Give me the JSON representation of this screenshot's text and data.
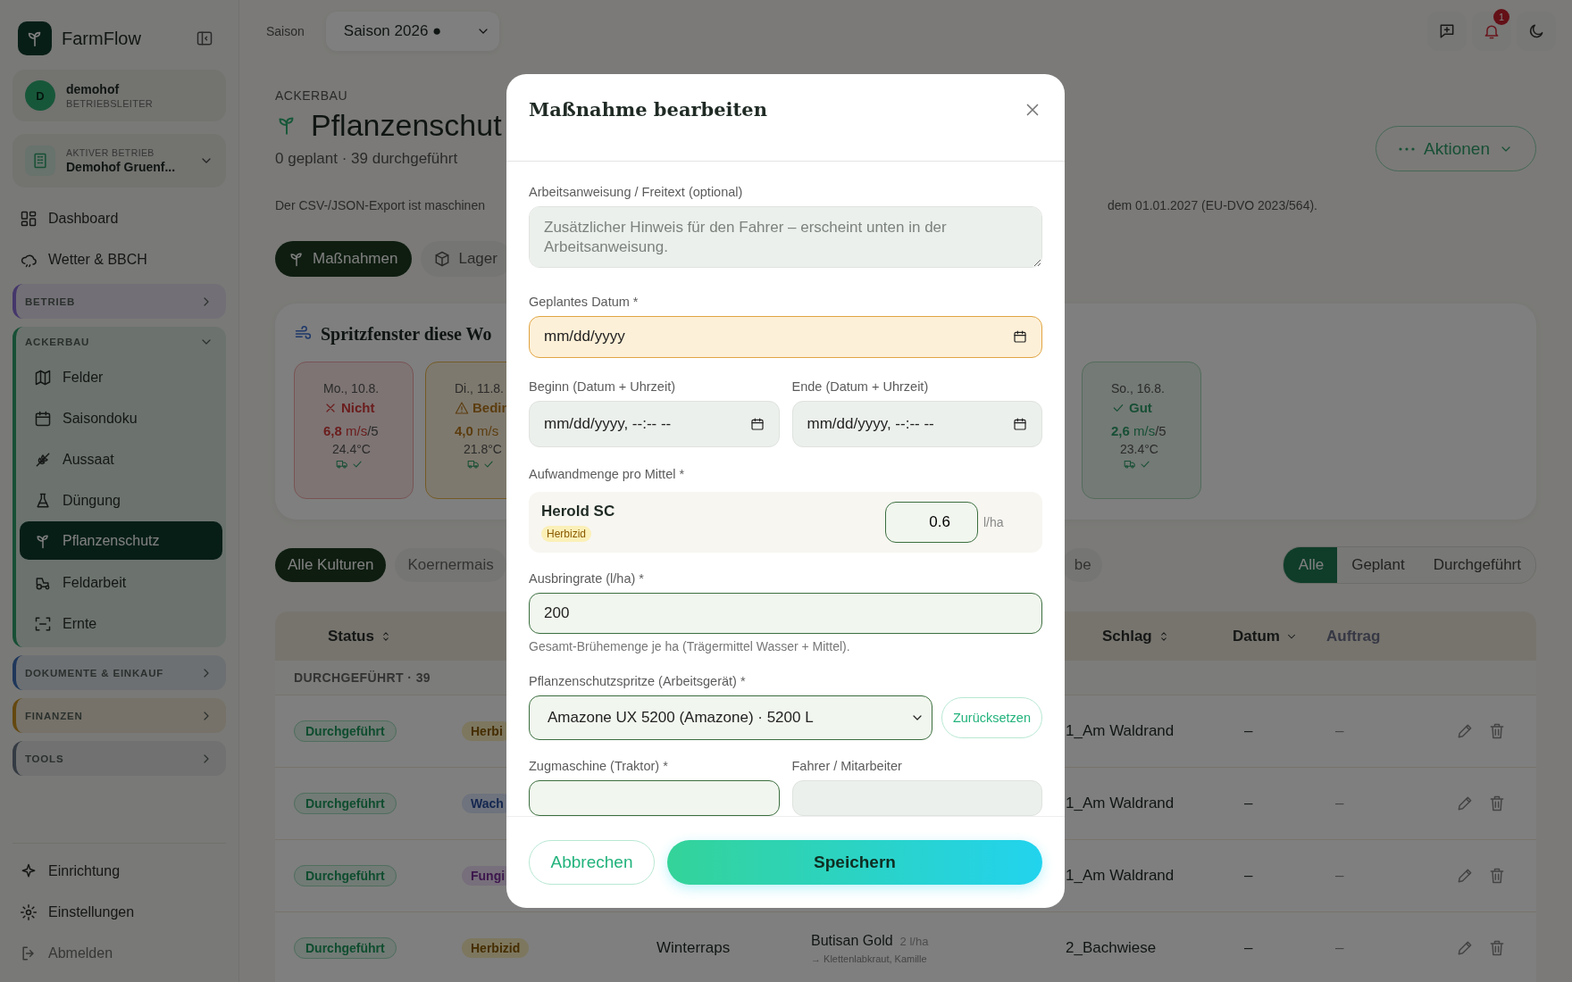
{
  "sidebar": {
    "brand": "FarmFlow",
    "user": {
      "initial": "D",
      "name": "demohof",
      "role": "BETRIEBSLEITER"
    },
    "farm": {
      "label": "AKTIVER BETRIEB",
      "name": "Demohof Gruenf..."
    },
    "nav": [
      {
        "label": "Dashboard",
        "selected": false
      },
      {
        "label": "Wetter & BBCH",
        "selected": false
      }
    ],
    "groups": [
      {
        "label": "BETRIEB",
        "kind": "company",
        "expanded": false
      },
      {
        "label": "ACKERBAU",
        "kind": "crops",
        "expanded": true,
        "items": [
          {
            "label": "Felder",
            "selected": false
          },
          {
            "label": "Saisondoku",
            "selected": false
          },
          {
            "label": "Aussaat",
            "selected": false
          },
          {
            "label": "Düngung",
            "selected": false
          },
          {
            "label": "Pflanzenschutz",
            "selected": true
          },
          {
            "label": "Feldarbeit",
            "selected": false
          },
          {
            "label": "Ernte",
            "selected": false
          }
        ]
      },
      {
        "label": "DOKUMENTE & EINKAUF",
        "kind": "documents",
        "expanded": false
      },
      {
        "label": "FINANZEN",
        "kind": "finance",
        "expanded": false
      },
      {
        "label": "TOOLS",
        "kind": "tools",
        "expanded": false
      }
    ],
    "footer": [
      {
        "label": "Einrichtung"
      },
      {
        "label": "Einstellungen"
      },
      {
        "label": "Abmelden"
      }
    ]
  },
  "topbar": {
    "season_label": "Saison",
    "season": "Saison 2026 ●",
    "notifications": "1"
  },
  "page": {
    "section": "ACKERBAU",
    "title": "Pflanzenschut",
    "subtitle": "0 geplant · 39 durchgeführt",
    "notice_start": "Der CSV-/JSON-Export ist maschinen",
    "notice_end": "dem 01.01.2027 (EU-DVO 2023/564).",
    "actions": "Aktionen",
    "tabs": [
      {
        "label": "Maßnahmen",
        "selected": true
      },
      {
        "label": "Lager",
        "selected": false
      }
    ],
    "spray_window": {
      "title": "Spritzfenster diese Wo",
      "days": [
        {
          "day": "Mo., 10.8.",
          "verdict": "Nicht",
          "kind": "bad",
          "wind": "6,8",
          "unit": "m/s",
          "max": "/5",
          "temp": "24.4°C"
        },
        {
          "day": "Di., 11.8.",
          "verdict": "Bedin",
          "kind": "limited",
          "wind": "4,0",
          "unit": "m/s",
          "temp": "21.8°C"
        }
      ],
      "days_after": [
        {
          "day": "So., 16.8.",
          "verdict": "Gut",
          "kind": "good",
          "wind": "2,6",
          "unit": "m/s",
          "max": "/5",
          "temp": "23.4°C"
        }
      ]
    },
    "crop_filters": [
      {
        "label": "Alle Kulturen",
        "selected": true
      },
      {
        "label": "Koernermais",
        "selected": false
      }
    ],
    "crop_filter_tail": {
      "label": "be",
      "selected": false
    },
    "status_filter": [
      {
        "label": "Alle",
        "selected": true
      },
      {
        "label": "Geplant",
        "selected": false
      },
      {
        "label": "Durchgeführt",
        "selected": false
      }
    ],
    "table": {
      "columns_left": [
        {
          "label": "Status",
          "sortable": true
        }
      ],
      "columns_right": [
        {
          "label": "Schlag",
          "sortable": true
        },
        {
          "label": "Datum",
          "sortable": true,
          "sorted": true
        },
        {
          "label": "Auftrag",
          "sortable": false
        }
      ],
      "group": "DURCHGEFÜHRT · 39",
      "rows": [
        {
          "status": "Durchgeführt",
          "type": {
            "label": "Herbi",
            "kind": "herbizid"
          },
          "field": "1_Am Waldrand",
          "date": "–",
          "order": "–"
        },
        {
          "status": "Durchgeführt",
          "type": {
            "label": "Wach",
            "kind": "regulator"
          },
          "field": "1_Am Waldrand",
          "date": "–",
          "order": "–"
        },
        {
          "status": "Durchgeführt",
          "type": {
            "label": "Fungi",
            "kind": "fungizid"
          },
          "field": "1_Am Waldrand",
          "date": "–",
          "order": "–"
        },
        {
          "status": "Durchgeführt",
          "type": {
            "label": "Herbizid",
            "kind": "herbizid"
          },
          "crop": "Winterraps",
          "agent": {
            "name": "Butisan Gold",
            "dose": "2 l/ha",
            "targets": "→ Klettenlabkraut, Kamille"
          },
          "field": "2_Bachwiese",
          "date": "–",
          "order": "–"
        }
      ]
    }
  },
  "modal": {
    "title": "Maßnahme bearbeiten",
    "note": {
      "label": "Arbeitsanweisung / Freitext (optional)",
      "placeholder": "Zusätzlicher Hinweis für den Fahrer – erscheint unten in der Arbeitsanweisung."
    },
    "planned_date": {
      "label": "Geplantes Datum *",
      "placeholder": "mm/dd/yyyy",
      "highlighted": true
    },
    "start": {
      "label": "Beginn (Datum + Uhrzeit)",
      "placeholder": "mm/dd/yyyy, --:-- --",
      "highlighted": false
    },
    "end": {
      "label": "Ende (Datum + Uhrzeit)",
      "placeholder": "mm/dd/yyyy, --:-- --",
      "highlighted": false
    },
    "rates": {
      "label": "Aufwandmenge pro Mittel *",
      "items": [
        {
          "name": "Herold SC",
          "tag": "Herbizid",
          "value": "0.6",
          "unit": "l/ha"
        }
      ]
    },
    "spray_rate": {
      "label": "Ausbringrate (l/ha) *",
      "value": "200",
      "help": "Gesamt-Brühemenge je ha (Trägermittel Wasser + Mittel)."
    },
    "sprayer": {
      "label": "Pflanzenschutzspritze (Arbeitsgerät) *",
      "value": "Amazone UX 5200 (Amazone) · 5200 L",
      "reset": "Zurücksetzen"
    },
    "tractor": {
      "label": "Zugmaschine (Traktor) *"
    },
    "driver": {
      "label": "Fahrer / Mitarbeiter"
    },
    "cancel": "Abbrechen",
    "save": "Speichern"
  }
}
